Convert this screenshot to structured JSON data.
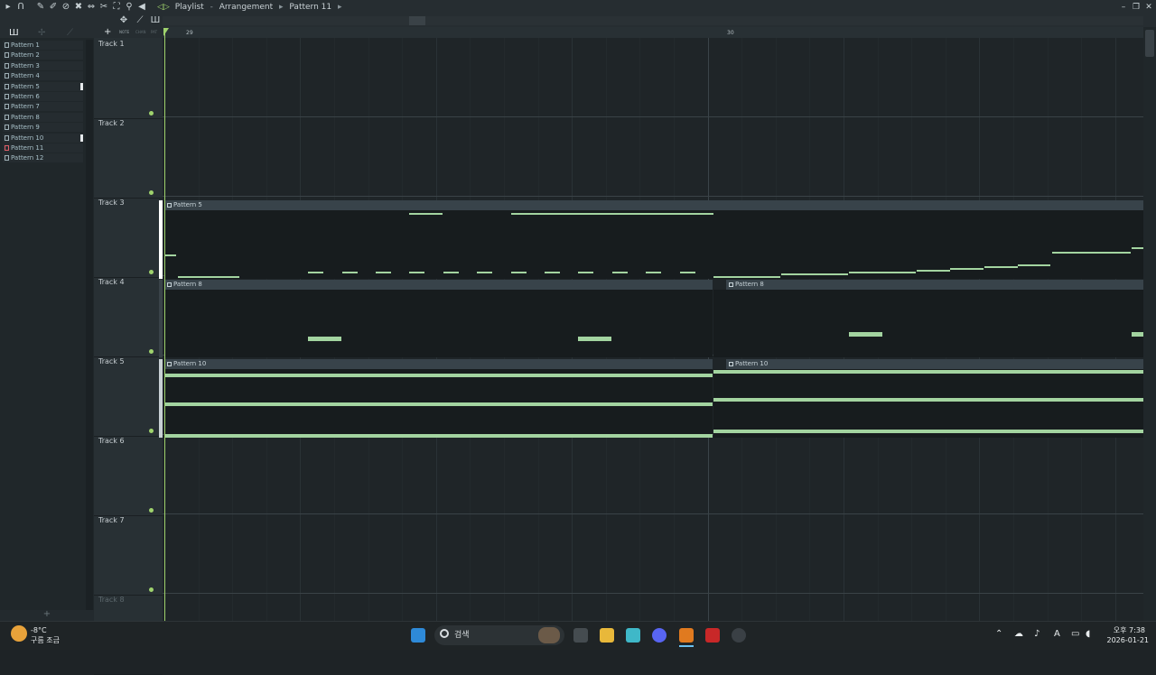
{
  "window": {
    "title_parts": [
      "Playlist",
      "Arrangement",
      "Pattern 11"
    ]
  },
  "toolbar": {
    "tool_labels": [
      "NOTE",
      "CHAN",
      "PAT"
    ]
  },
  "browser": {
    "patterns": [
      {
        "label": "Pattern 1"
      },
      {
        "label": "Pattern 2"
      },
      {
        "label": "Pattern 3"
      },
      {
        "label": "Pattern 4"
      },
      {
        "label": "Pattern 5"
      },
      {
        "label": "Pattern 6"
      },
      {
        "label": "Pattern 7"
      },
      {
        "label": "Pattern 8"
      },
      {
        "label": "Pattern 9"
      },
      {
        "label": "Pattern 10"
      },
      {
        "label": "Pattern 11"
      },
      {
        "label": "Pattern 12"
      }
    ],
    "add_label": "+"
  },
  "ruler": {
    "bar_start": "29",
    "bar_mid": "30"
  },
  "tracks": [
    "Track 1",
    "Track 2",
    "Track 3",
    "Track 4",
    "Track 5",
    "Track 6",
    "Track 7",
    "Track 8"
  ],
  "clips": {
    "track3_a": "Pattern 5",
    "track4_a": "Pattern 8",
    "track4_b": "Pattern 8",
    "track5_a": "Pattern 10",
    "track5_b": "Pattern 10"
  },
  "taskbar": {
    "weather_temp": "-8°C",
    "weather_desc": "구름 조금",
    "search_placeholder": "검색",
    "time": "오후 7:38",
    "date": "2026-01-21"
  },
  "colors": {
    "accent": "#9fd36d",
    "note": "#a3d4a0",
    "background": "#1f2528"
  }
}
